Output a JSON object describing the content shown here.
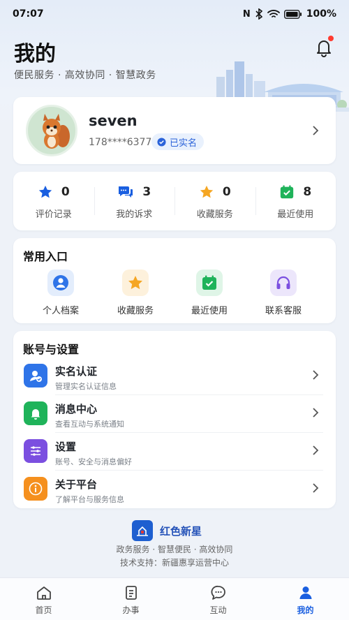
{
  "status_bar": {
    "time": "07:07",
    "battery": "100%"
  },
  "header": {
    "title": "我的",
    "subtitle": "便民服务 · 高效协同 · 智慧政务"
  },
  "profile": {
    "username": "seven",
    "phone": "178****6377",
    "verified_label": "已实名"
  },
  "stats": [
    {
      "count": "0",
      "label": "评价记录",
      "icon": "star-icon",
      "color": "#1a5fe0"
    },
    {
      "count": "3",
      "label": "我的诉求",
      "icon": "chat-icon",
      "color": "#1a5fe0"
    },
    {
      "count": "0",
      "label": "收藏服务",
      "icon": "star-icon",
      "color": "#f5a623"
    },
    {
      "count": "8",
      "label": "最近使用",
      "icon": "calendar-check-icon",
      "color": "#1fb35a"
    }
  ],
  "shortcuts": {
    "title": "常用入口",
    "items": [
      {
        "label": "个人档案",
        "icon": "person-icon",
        "color": "#2f74e8"
      },
      {
        "label": "收藏服务",
        "icon": "star-icon",
        "color": "#f5a623"
      },
      {
        "label": "最近使用",
        "icon": "calendar-check-icon",
        "color": "#1fb35a"
      },
      {
        "label": "联系客服",
        "icon": "headset-icon",
        "color": "#7b4fe0"
      }
    ]
  },
  "settings": {
    "title": "账号与设置",
    "items": [
      {
        "title": "实名认证",
        "desc": "管理实名认证信息",
        "icon": "id-card-icon",
        "color": "#2f74e8"
      },
      {
        "title": "消息中心",
        "desc": "查看互动与系统通知",
        "icon": "bell-icon",
        "color": "#1fb35a"
      },
      {
        "title": "设置",
        "desc": "账号、安全与消息偏好",
        "icon": "sliders-icon",
        "color": "#7b4fe0"
      },
      {
        "title": "关于平台",
        "desc": "了解平台与服务信息",
        "icon": "info-icon",
        "color": "#f5901e"
      }
    ]
  },
  "footer": {
    "brand_name": "红色新星",
    "tagline": "政务服务 · 智慧便民 · 高效协同",
    "support": "技术支持：新疆惠享运营中心"
  },
  "tabbar": [
    {
      "label": "首页",
      "icon": "home-icon",
      "active": false
    },
    {
      "label": "办事",
      "icon": "document-icon",
      "active": false
    },
    {
      "label": "互动",
      "icon": "chat-bubble-icon",
      "active": false
    },
    {
      "label": "我的",
      "icon": "person-icon",
      "active": true
    }
  ]
}
